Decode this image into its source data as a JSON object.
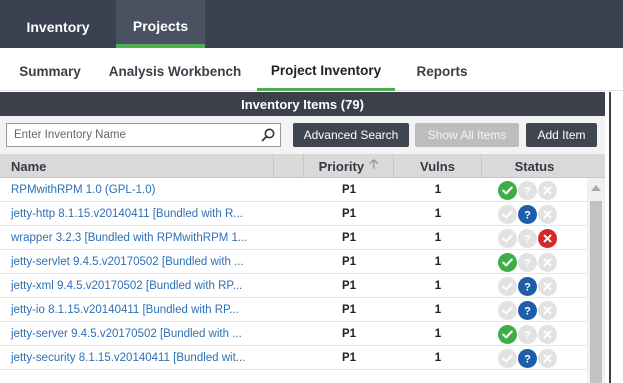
{
  "topnav": {
    "tabs": [
      {
        "label": "Inventory"
      },
      {
        "label": "Projects"
      }
    ]
  },
  "subnav": {
    "tabs": [
      {
        "label": "Summary"
      },
      {
        "label": "Analysis Workbench"
      },
      {
        "label": "Project Inventory"
      },
      {
        "label": "Reports"
      }
    ]
  },
  "panel": {
    "title": "Inventory Items (79)"
  },
  "toolbar": {
    "search_placeholder": "Enter Inventory Name",
    "advanced_search_label": "Advanced Search",
    "show_all_label": "Show All Items",
    "add_item_label": "Add Item"
  },
  "table": {
    "columns": {
      "name": "Name",
      "priority": "Priority",
      "vulns": "Vulns",
      "status": "Status"
    },
    "sort_icon": "arrow-up-icon",
    "rows": [
      {
        "name": "RPMwithRPM 1.0  (GPL-1.0)",
        "priority": "P1",
        "vulns": "1",
        "status": "approved"
      },
      {
        "name": "jetty-http 8.1.15.v20140411  [Bundled with R...",
        "priority": "P1",
        "vulns": "1",
        "status": "unknown"
      },
      {
        "name": "wrapper 3.2.3  [Bundled with RPMwithRPM 1...",
        "priority": "P1",
        "vulns": "1",
        "status": "rejected"
      },
      {
        "name": "jetty-servlet 9.4.5.v20170502  [Bundled with ...",
        "priority": "P1",
        "vulns": "1",
        "status": "approved"
      },
      {
        "name": "jetty-xml 9.4.5.v20170502  [Bundled with RP...",
        "priority": "P1",
        "vulns": "1",
        "status": "unknown"
      },
      {
        "name": "jetty-io 8.1.15.v20140411  [Bundled with RP...",
        "priority": "P1",
        "vulns": "1",
        "status": "unknown"
      },
      {
        "name": "jetty-server 9.4.5.v20170502  [Bundled with ...",
        "priority": "P1",
        "vulns": "1",
        "status": "approved"
      },
      {
        "name": "jetty-security 8.1.15.v20140411  [Bundled wit...",
        "priority": "P1",
        "vulns": "1",
        "status": "unknown"
      }
    ]
  },
  "colors": {
    "nav_bg": "#3a4150",
    "accent_green": "#4caf50",
    "link_blue": "#2e6fb6",
    "approved": "#3fae49",
    "unknown": "#1e5ea8",
    "rejected": "#d42a2a"
  }
}
